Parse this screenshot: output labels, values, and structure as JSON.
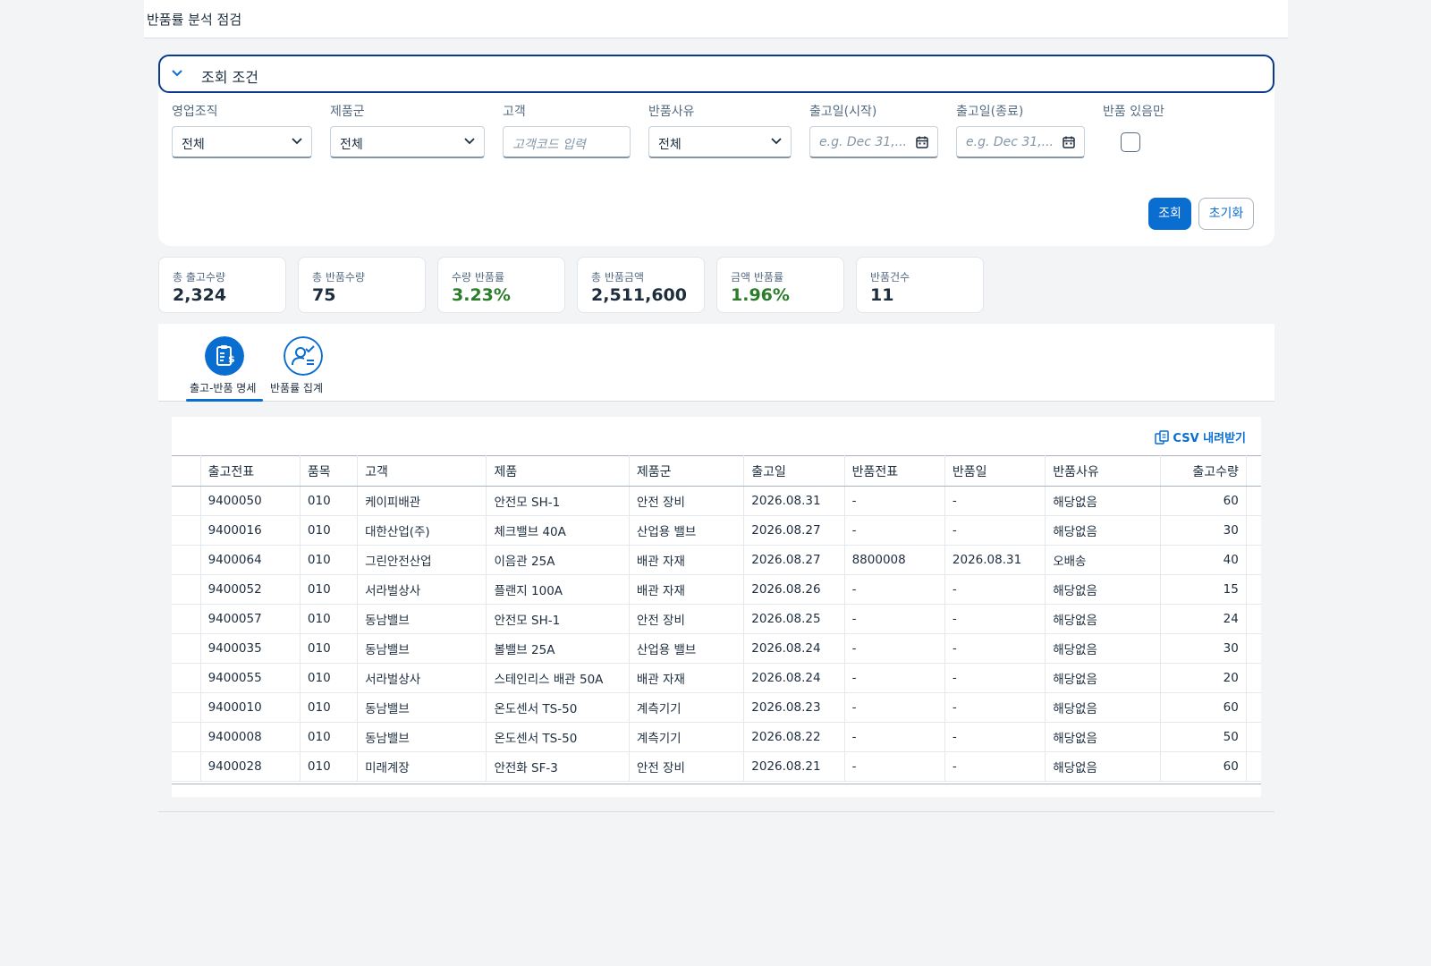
{
  "app": {
    "title": "반품률 분석 점검"
  },
  "filter": {
    "header": "조회 조건",
    "fields": {
      "org_label": "영업조직",
      "org_value": "전체",
      "group_label": "제품군",
      "group_value": "전체",
      "customer_label": "고객",
      "customer_placeholder": "고객코드 입력",
      "reason_label": "반품사유",
      "reason_value": "전체",
      "start_label": "출고일(시작)",
      "start_placeholder": "e.g. Dec 31,...",
      "end_label": "출고일(종료)",
      "end_placeholder": "e.g. Dec 31,...",
      "returns_only_label": "반품 있음만"
    },
    "search_button": "조회",
    "reset_button": "초기화"
  },
  "kpis": [
    {
      "label": "총 출고수량",
      "value": "2,324"
    },
    {
      "label": "총 반품수량",
      "value": "75"
    },
    {
      "label": "수량 반품률",
      "value": "3.23%"
    },
    {
      "label": "총 반품금액",
      "value": "2,511,600"
    },
    {
      "label": "금액 반품률",
      "value": "1.96%"
    },
    {
      "label": "반품건수",
      "value": "11"
    }
  ],
  "tabs": [
    {
      "label": "출고-반품 명세",
      "icon": "clipboard-money-icon"
    },
    {
      "label": "반품률 집계",
      "icon": "user-check-icon"
    }
  ],
  "table": {
    "csv_label": "CSV 내려받기",
    "columns": [
      "출고전표",
      "품목",
      "고객",
      "제품",
      "제품군",
      "출고일",
      "반품전표",
      "반품일",
      "반품사유",
      "출고수량"
    ],
    "rows": [
      [
        "9400050",
        "010",
        "케이피배관",
        "안전모 SH-1",
        "안전 장비",
        "2026.08.31",
        "-",
        "-",
        "해당없음",
        "60"
      ],
      [
        "9400016",
        "010",
        "대한산업(주)",
        "체크밸브 40A",
        "산업용 밸브",
        "2026.08.27",
        "-",
        "-",
        "해당없음",
        "30"
      ],
      [
        "9400064",
        "010",
        "그린안전산업",
        "이음관 25A",
        "배관 자재",
        "2026.08.27",
        "8800008",
        "2026.08.31",
        "오배송",
        "40"
      ],
      [
        "9400052",
        "010",
        "서라벌상사",
        "플랜지 100A",
        "배관 자재",
        "2026.08.26",
        "-",
        "-",
        "해당없음",
        "15"
      ],
      [
        "9400057",
        "010",
        "동남밸브",
        "안전모 SH-1",
        "안전 장비",
        "2026.08.25",
        "-",
        "-",
        "해당없음",
        "24"
      ],
      [
        "9400035",
        "010",
        "동남밸브",
        "볼밸브 25A",
        "산업용 밸브",
        "2026.08.24",
        "-",
        "-",
        "해당없음",
        "30"
      ],
      [
        "9400055",
        "010",
        "서라벌상사",
        "스테인리스 배관 50A",
        "배관 자재",
        "2026.08.24",
        "-",
        "-",
        "해당없음",
        "20"
      ],
      [
        "9400010",
        "010",
        "동남밸브",
        "온도센서 TS-50",
        "계측기기",
        "2026.08.23",
        "-",
        "-",
        "해당없음",
        "60"
      ],
      [
        "9400008",
        "010",
        "동남밸브",
        "온도센서 TS-50",
        "계측기기",
        "2026.08.22",
        "-",
        "-",
        "해당없음",
        "50"
      ],
      [
        "9400028",
        "010",
        "미래계장",
        "안전화 SF-3",
        "안전 장비",
        "2026.08.21",
        "-",
        "-",
        "해당없음",
        "60"
      ]
    ]
  },
  "colors": {
    "accent": "#0a6ed1",
    "green": "#2b7d2b",
    "header_border": "#0a3a8c"
  }
}
